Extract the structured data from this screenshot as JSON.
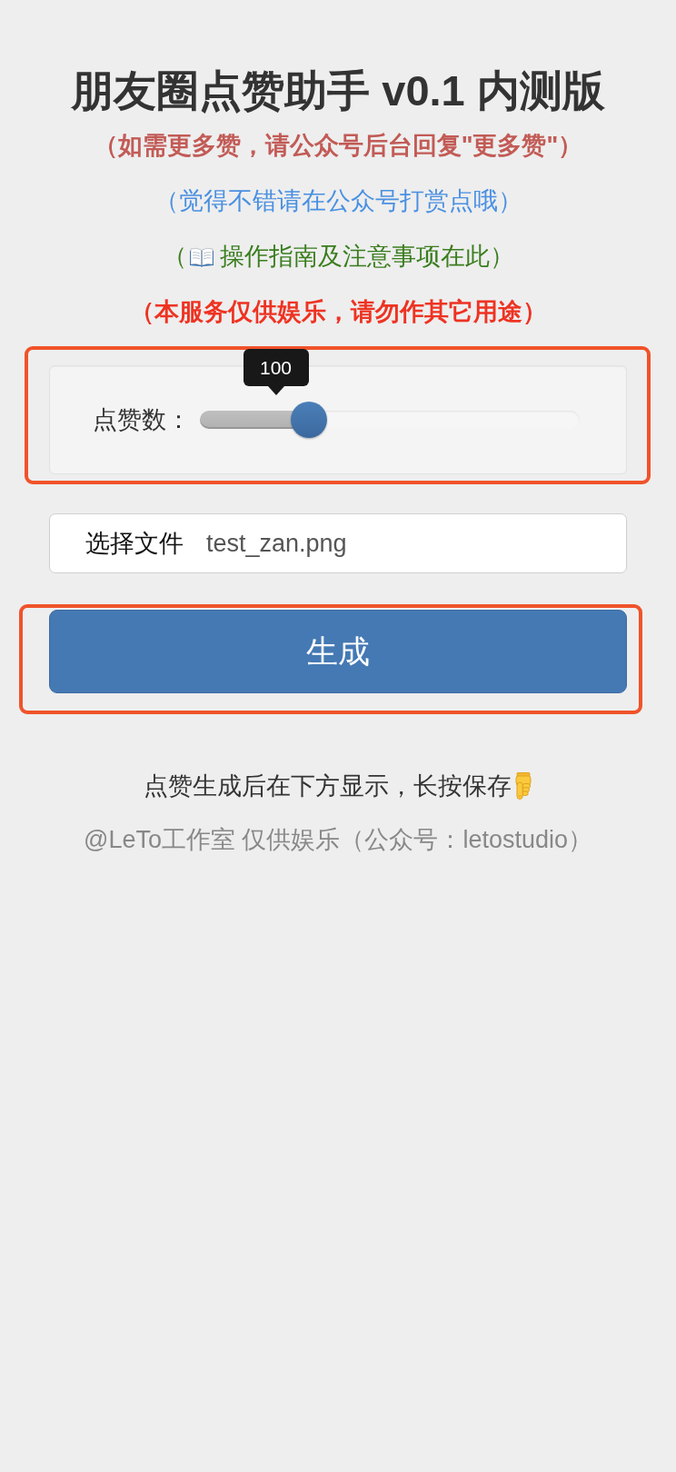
{
  "title": "朋友圈点赞助手 v0.1 内测版",
  "notices": [
    {
      "kind": "text",
      "text": "（如需更多赞，请公众号后台回复\"更多赞\"）",
      "color": "#c25b56",
      "bold": true
    },
    {
      "kind": "text",
      "text": "（觉得不错请在公众号打赏点哦）",
      "color": "#4a90e2",
      "bold": false
    },
    {
      "kind": "guide",
      "before": "（",
      "text": "操作指南及注意事项在此）",
      "color": "#3a7d1e",
      "bold": false
    },
    {
      "kind": "text",
      "text": "（本服务仅供娱乐，请勿作其它用途）",
      "color": "#ee3322",
      "bold": true
    }
  ],
  "likes_panel": {
    "highlighted": true,
    "label": "点赞数：",
    "value": "100",
    "level": 0.286
  },
  "file_picker": {
    "button": "选择文件",
    "file_name": "test_zan.png"
  },
  "generate_button": {
    "label": "生成",
    "highlighted": true
  },
  "footer": {
    "hint": "点赞生成后在下方显示，长按保存",
    "credit": "@LeTo工作室 仅供娱乐（公众号：letostudio）"
  }
}
